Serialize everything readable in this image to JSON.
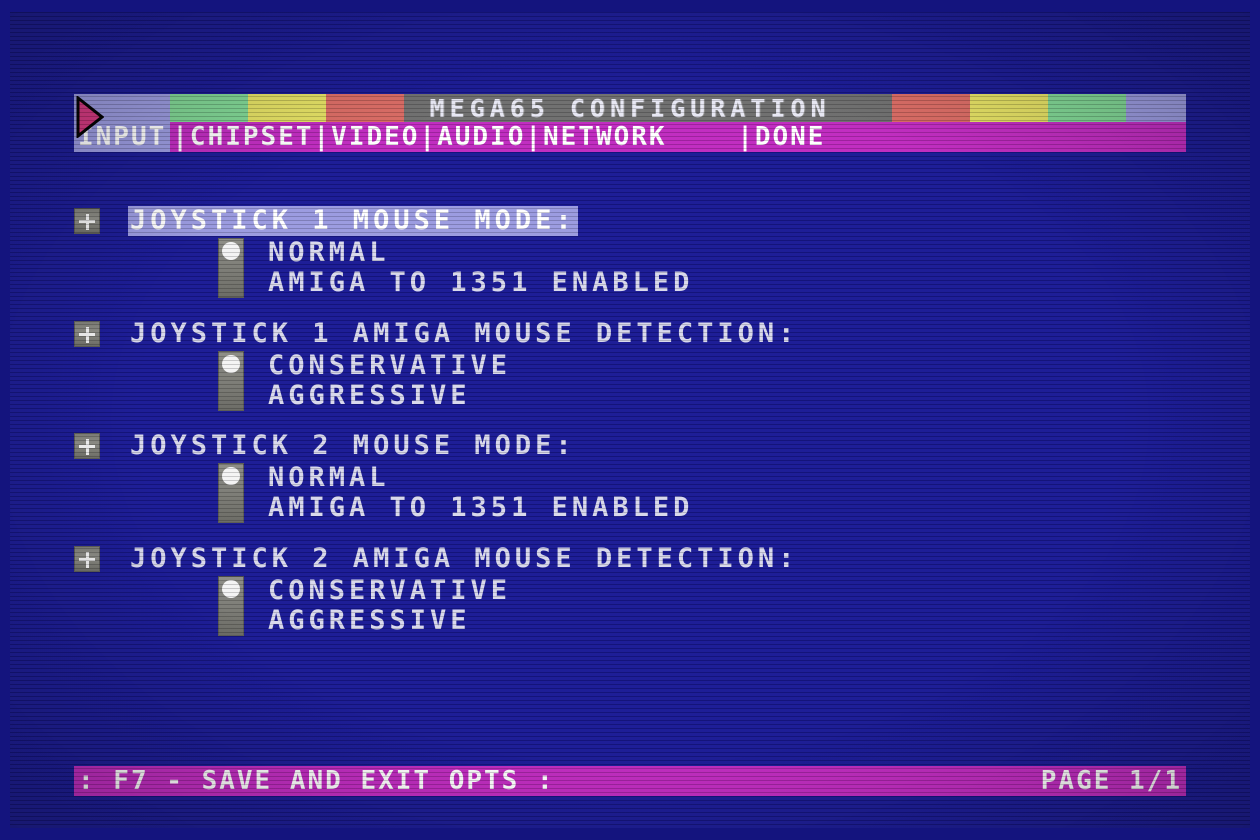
{
  "screen": {
    "title": "MEGA65 CONFIGURATION",
    "background_color": "#191995",
    "border_color": "#14147e",
    "accent_magenta": "#c02ac0",
    "accent_lavender": "#9a9ae0",
    "text_color": "#d8d8ec"
  },
  "titlebar": {
    "text": "MEGA65 CONFIGURATION",
    "segments_left": [
      "#9a9ae0",
      "#7fd694",
      "#e3df62",
      "#d96a63",
      "#6e6e6e"
    ],
    "segments_right": [
      "#6e6e6e",
      "#d96a63",
      "#e3df62",
      "#7fd694",
      "#9a9ae0"
    ]
  },
  "tabs": {
    "active": "INPUT",
    "rest": "|CHIPSET|VIDEO|AUDIO|NETWORK    |DONE",
    "items": [
      "INPUT",
      "CHIPSET",
      "VIDEO",
      "AUDIO",
      "NETWORK",
      "DONE"
    ]
  },
  "cursor": {
    "icon": "pointer-triangle-icon",
    "fill": "#d6367f",
    "outline": "#000000"
  },
  "groups": [
    {
      "toggle_icon": "plus-box-icon",
      "label": "JOYSTICK 1 MOUSE MODE:",
      "selected": true,
      "selected_index": 0,
      "options": [
        "NORMAL",
        "AMIGA TO 1351 ENABLED"
      ]
    },
    {
      "toggle_icon": "plus-box-icon",
      "label": "JOYSTICK 1 AMIGA MOUSE DETECTION:",
      "selected": false,
      "selected_index": 0,
      "options": [
        "CONSERVATIVE",
        "AGGRESSIVE"
      ]
    },
    {
      "toggle_icon": "plus-box-icon",
      "label": "JOYSTICK 2 MOUSE MODE:",
      "selected": false,
      "selected_index": 0,
      "options": [
        "NORMAL",
        "AMIGA TO 1351 ENABLED"
      ]
    },
    {
      "toggle_icon": "plus-box-icon",
      "label": "JOYSTICK 2 AMIGA MOUSE DETECTION:",
      "selected": false,
      "selected_index": 0,
      "options": [
        "CONSERVATIVE",
        "AGGRESSIVE"
      ]
    }
  ],
  "footer": {
    "left": ": F7 - SAVE AND EXIT OPTS :",
    "right": "PAGE 1/1"
  }
}
